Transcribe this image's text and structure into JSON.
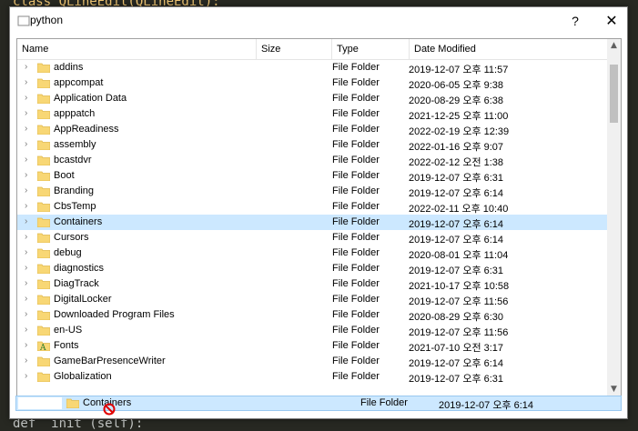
{
  "background": {
    "top_code": "class QLineEdit(QLineEdit):",
    "bottom_code": "def  init (self):"
  },
  "window": {
    "title": "python",
    "help_label": "?",
    "close_label": "✕"
  },
  "columns": [
    "Name",
    "Size",
    "Type",
    "Date Modified"
  ],
  "rows": [
    {
      "name": "addins",
      "type": "File Folder",
      "date": "2019-12-07 오후 11:57",
      "icon": "folder-icon"
    },
    {
      "name": "appcompat",
      "type": "File Folder",
      "date": "2020-06-05 오후 9:38",
      "icon": "folder-icon"
    },
    {
      "name": "Application Data",
      "type": "File Folder",
      "date": "2020-08-29 오후 6:38",
      "icon": "folder-icon"
    },
    {
      "name": "apppatch",
      "type": "File Folder",
      "date": "2021-12-25 오후 11:00",
      "icon": "folder-icon"
    },
    {
      "name": "AppReadiness",
      "type": "File Folder",
      "date": "2022-02-19 오후 12:39",
      "icon": "folder-icon"
    },
    {
      "name": "assembly",
      "type": "File Folder",
      "date": "2022-01-16 오후 9:07",
      "icon": "folder-icon"
    },
    {
      "name": "bcastdvr",
      "type": "File Folder",
      "date": "2022-02-12 오전 1:38",
      "icon": "folder-icon"
    },
    {
      "name": "Boot",
      "type": "File Folder",
      "date": "2019-12-07 오후 6:31",
      "icon": "folder-icon"
    },
    {
      "name": "Branding",
      "type": "File Folder",
      "date": "2019-12-07 오후 6:14",
      "icon": "folder-icon"
    },
    {
      "name": "CbsTemp",
      "type": "File Folder",
      "date": "2022-02-11 오후 10:40",
      "icon": "folder-icon"
    },
    {
      "name": "Containers",
      "type": "File Folder",
      "date": "2019-12-07 오후 6:14",
      "icon": "folder-icon",
      "selected": true
    },
    {
      "name": "Cursors",
      "type": "File Folder",
      "date": "2019-12-07 오후 6:14",
      "icon": "folder-icon"
    },
    {
      "name": "debug",
      "type": "File Folder",
      "date": "2020-08-01 오후 11:04",
      "icon": "folder-icon"
    },
    {
      "name": "diagnostics",
      "type": "File Folder",
      "date": "2019-12-07 오후 6:31",
      "icon": "folder-icon"
    },
    {
      "name": "DiagTrack",
      "type": "File Folder",
      "date": "2021-10-17 오후 10:58",
      "icon": "folder-icon"
    },
    {
      "name": "DigitalLocker",
      "type": "File Folder",
      "date": "2019-12-07 오후 11:56",
      "icon": "folder-icon"
    },
    {
      "name": "Downloaded Program Files",
      "type": "File Folder",
      "date": "2020-08-29 오후 6:30",
      "icon": "folder-icon"
    },
    {
      "name": "en-US",
      "type": "File Folder",
      "date": "2019-12-07 오후 11:56",
      "icon": "folder-icon"
    },
    {
      "name": "Fonts",
      "type": "File Folder",
      "date": "2021-07-10 오전 3:17",
      "icon": "fonts-folder-icon"
    },
    {
      "name": "GameBarPresenceWriter",
      "type": "File Folder",
      "date": "2019-12-07 오후 6:14",
      "icon": "folder-icon"
    },
    {
      "name": "Globalization",
      "type": "File Folder",
      "date": "2019-12-07 오후 6:31",
      "icon": "folder-icon"
    }
  ],
  "drag_preview": {
    "name": "Containers",
    "type": "File Folder",
    "date": "2019-12-07 오후 6:14"
  },
  "colors": {
    "selection": "#cce8ff",
    "folder": "#f8d775",
    "folder_dark": "#e0b84a"
  }
}
